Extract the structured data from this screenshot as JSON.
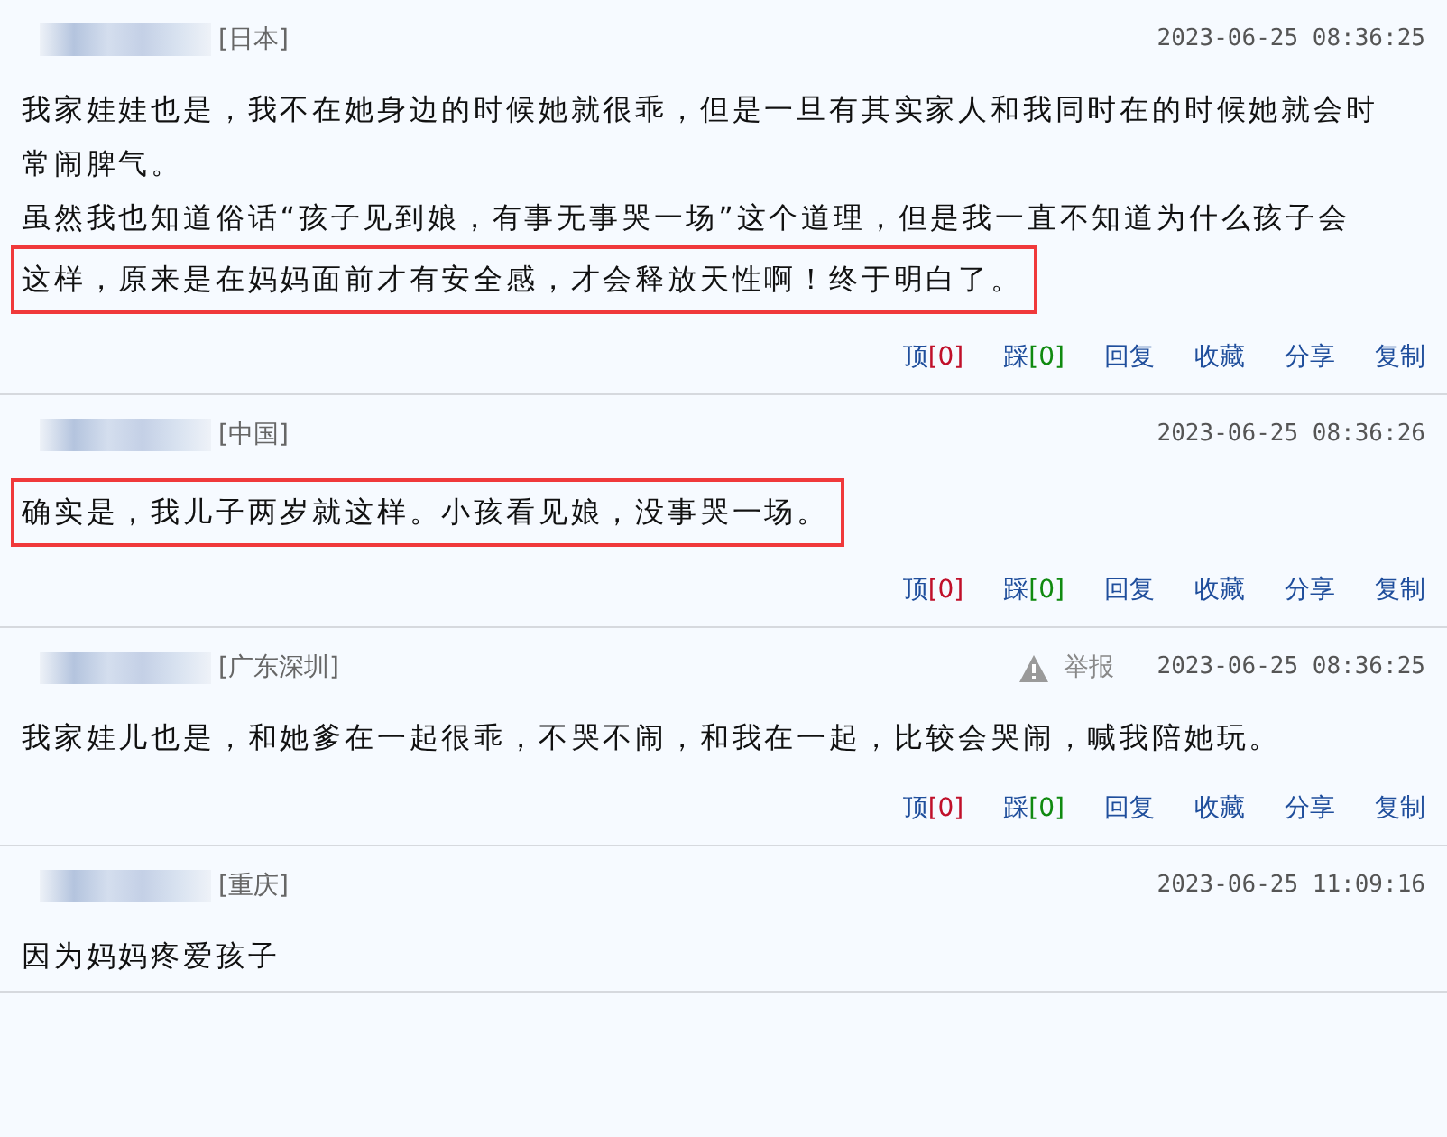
{
  "comments": [
    {
      "location": "[日本]",
      "time": "2023-06-25 08:36:25",
      "lines": [
        {
          "text": "我家娃娃也是，我不在她身边的时候她就很乖，但是一旦有其实家人和我同时在的时候她就会时",
          "highlighted": false
        },
        {
          "text": "常闹脾气。",
          "highlighted": false
        },
        {
          "text": "虽然我也知道俗话“孩子见到娘，有事无事哭一场”这个道理，但是我一直不知道为什么孩子会",
          "highlighted": false
        },
        {
          "text": "这样，原来是在妈妈面前才有安全感，才会释放天性啊！终于明白了。",
          "highlighted": true
        }
      ],
      "actions": [
        {
          "kind": "up",
          "label": "顶",
          "count": "[0]"
        },
        {
          "kind": "down",
          "label": "踩",
          "count": "[0]"
        },
        {
          "kind": "plain",
          "label": "回复"
        },
        {
          "kind": "plain",
          "label": "收藏"
        },
        {
          "kind": "plain",
          "label": "分享"
        },
        {
          "kind": "plain",
          "label": "复制"
        }
      ]
    },
    {
      "location": "[中国]",
      "time": "2023-06-25 08:36:26",
      "lines": [
        {
          "text": "确实是，我儿子两岁就这样。小孩看见娘，没事哭一场。",
          "highlighted": true
        }
      ],
      "actions": [
        {
          "kind": "up",
          "label": "顶",
          "count": "[0]"
        },
        {
          "kind": "down",
          "label": "踩",
          "count": "[0]"
        },
        {
          "kind": "plain",
          "label": "回复"
        },
        {
          "kind": "plain",
          "label": "收藏"
        },
        {
          "kind": "plain",
          "label": "分享"
        },
        {
          "kind": "plain",
          "label": "复制"
        }
      ]
    },
    {
      "location": "[广东深圳]",
      "report": "举报",
      "time": "2023-06-25 08:36:25",
      "lines": [
        {
          "text": "我家娃儿也是，和她爹在一起很乖，不哭不闹，和我在一起，比较会哭闹，喊我陪她玩。",
          "highlighted": false
        }
      ],
      "actions": [
        {
          "kind": "up",
          "label": "顶",
          "count": "[0]"
        },
        {
          "kind": "down",
          "label": "踩",
          "count": "[0]"
        },
        {
          "kind": "plain",
          "label": "回复"
        },
        {
          "kind": "plain",
          "label": "收藏"
        },
        {
          "kind": "plain",
          "label": "分享"
        },
        {
          "kind": "plain",
          "label": "复制"
        }
      ]
    },
    {
      "location": "[重庆]",
      "time": "2023-06-25 11:09:16",
      "lines": [
        {
          "text": "因为妈妈疼爱孩子",
          "highlighted": false
        }
      ]
    }
  ]
}
